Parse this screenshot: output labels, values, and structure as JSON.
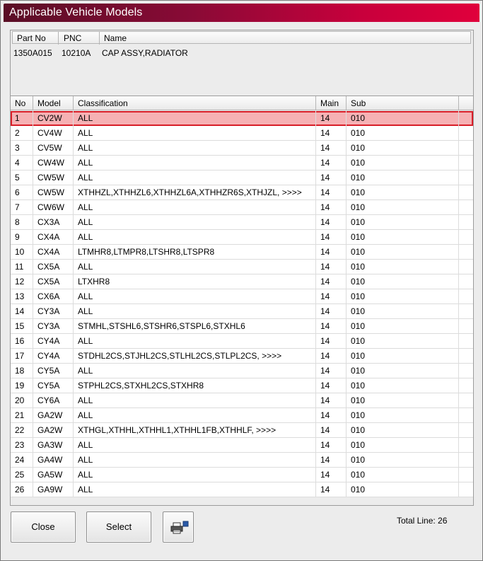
{
  "window": {
    "title": "Applicable Vehicle Models"
  },
  "part_info": {
    "headers": [
      "Part No",
      "PNC",
      "Name"
    ],
    "part_no": "1350A015",
    "pnc": "10210A",
    "name": "CAP ASSY,RADIATOR"
  },
  "table": {
    "headers": [
      "No",
      "Model",
      "Classification",
      "Main",
      "Sub"
    ],
    "selected_index": 0,
    "rows": [
      {
        "no": "1",
        "model": "CV2W",
        "classification": "ALL",
        "main": "14",
        "sub": "010"
      },
      {
        "no": "2",
        "model": "CV4W",
        "classification": "ALL",
        "main": "14",
        "sub": "010"
      },
      {
        "no": "3",
        "model": "CV5W",
        "classification": "ALL",
        "main": "14",
        "sub": "010"
      },
      {
        "no": "4",
        "model": "CW4W",
        "classification": "ALL",
        "main": "14",
        "sub": "010"
      },
      {
        "no": "5",
        "model": "CW5W",
        "classification": "ALL",
        "main": "14",
        "sub": "010"
      },
      {
        "no": "6",
        "model": "CW5W",
        "classification": "XTHHZL,XTHHZL6,XTHHZL6A,XTHHZR6S,XTHJZL,   >>>>",
        "main": "14",
        "sub": "010"
      },
      {
        "no": "7",
        "model": "CW6W",
        "classification": "ALL",
        "main": "14",
        "sub": "010"
      },
      {
        "no": "8",
        "model": "CX3A",
        "classification": "ALL",
        "main": "14",
        "sub": "010"
      },
      {
        "no": "9",
        "model": "CX4A",
        "classification": "ALL",
        "main": "14",
        "sub": "010"
      },
      {
        "no": "10",
        "model": "CX4A",
        "classification": "LTMHR8,LTMPR8,LTSHR8,LTSPR8",
        "main": "14",
        "sub": "010"
      },
      {
        "no": "11",
        "model": "CX5A",
        "classification": "ALL",
        "main": "14",
        "sub": "010"
      },
      {
        "no": "12",
        "model": "CX5A",
        "classification": "LTXHR8",
        "main": "14",
        "sub": "010"
      },
      {
        "no": "13",
        "model": "CX6A",
        "classification": "ALL",
        "main": "14",
        "sub": "010"
      },
      {
        "no": "14",
        "model": "CY3A",
        "classification": "ALL",
        "main": "14",
        "sub": "010"
      },
      {
        "no": "15",
        "model": "CY3A",
        "classification": "STMHL,STSHL6,STSHR6,STSPL6,STXHL6",
        "main": "14",
        "sub": "010"
      },
      {
        "no": "16",
        "model": "CY4A",
        "classification": "ALL",
        "main": "14",
        "sub": "010"
      },
      {
        "no": "17",
        "model": "CY4A",
        "classification": "STDHL2CS,STJHL2CS,STLHL2CS,STLPL2CS,   >>>>",
        "main": "14",
        "sub": "010"
      },
      {
        "no": "18",
        "model": "CY5A",
        "classification": "ALL",
        "main": "14",
        "sub": "010"
      },
      {
        "no": "19",
        "model": "CY5A",
        "classification": "STPHL2CS,STXHL2CS,STXHR8",
        "main": "14",
        "sub": "010"
      },
      {
        "no": "20",
        "model": "CY6A",
        "classification": "ALL",
        "main": "14",
        "sub": "010"
      },
      {
        "no": "21",
        "model": "GA2W",
        "classification": "ALL",
        "main": "14",
        "sub": "010"
      },
      {
        "no": "22",
        "model": "GA2W",
        "classification": "XTHGL,XTHHL,XTHHL1,XTHHL1FB,XTHHLF,   >>>>",
        "main": "14",
        "sub": "010"
      },
      {
        "no": "23",
        "model": "GA3W",
        "classification": "ALL",
        "main": "14",
        "sub": "010"
      },
      {
        "no": "24",
        "model": "GA4W",
        "classification": "ALL",
        "main": "14",
        "sub": "010"
      },
      {
        "no": "25",
        "model": "GA5W",
        "classification": "ALL",
        "main": "14",
        "sub": "010"
      },
      {
        "no": "26",
        "model": "GA9W",
        "classification": "ALL",
        "main": "14",
        "sub": "010"
      }
    ]
  },
  "buttons": {
    "close": "Close",
    "select": "Select",
    "print_icon": "printer-icon"
  },
  "status": {
    "total_line": "Total Line: 26"
  },
  "colors": {
    "selected_fill": "#f6b1b4",
    "selected_border": "#d81e28",
    "title_gradient_end": "#e0003c"
  }
}
